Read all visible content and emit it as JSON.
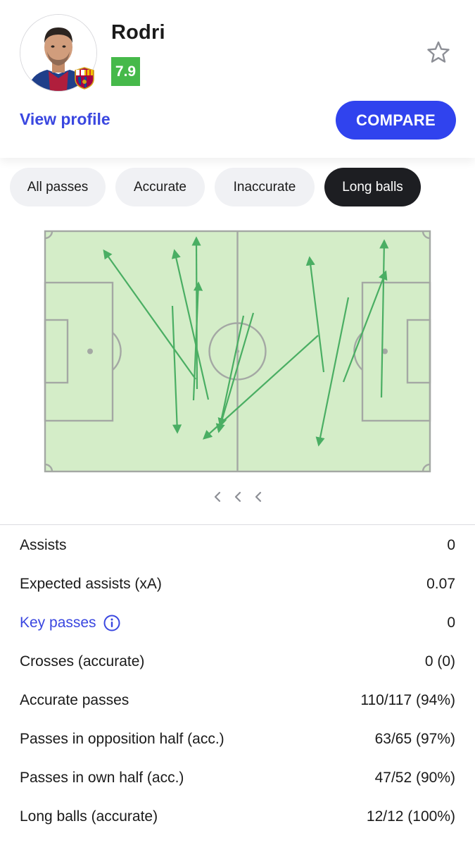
{
  "player": {
    "name": "Rodri",
    "rating": "7.9",
    "rating_color": "#46b94a",
    "club_badge": "fc-barcelona-crest",
    "view_profile_label": "View profile",
    "compare_label": "COMPARE"
  },
  "filters": [
    {
      "label": "All passes",
      "active": false
    },
    {
      "label": "Accurate",
      "active": false
    },
    {
      "label": "Inaccurate",
      "active": false
    },
    {
      "label": "Long balls",
      "active": true
    }
  ],
  "pitch": {
    "pass_color": "#4aae63",
    "passes_shown": 12
  },
  "stats": [
    {
      "label": "Assists",
      "value": "0",
      "link": false
    },
    {
      "label": "Expected assists (xA)",
      "value": "0.07",
      "link": false
    },
    {
      "label": "Key passes",
      "value": "0",
      "link": true,
      "icon": "info-icon"
    },
    {
      "label": "Crosses (accurate)",
      "value": "0 (0)",
      "link": false
    },
    {
      "label": "Accurate passes",
      "value": "110/117 (94%)",
      "link": false
    },
    {
      "label": "Passes in opposition half (acc.)",
      "value": "63/65 (97%)",
      "link": false
    },
    {
      "label": "Passes in own half (acc.)",
      "value": "47/52 (90%)",
      "link": false
    },
    {
      "label": "Long balls (accurate)",
      "value": "12/12 (100%)",
      "link": false
    }
  ],
  "colors": {
    "accent": "#3043ee",
    "link": "#3a47e0",
    "pitch_fill": "#d4edc8",
    "pitch_lines": "#a4a8a4",
    "active_chip": "#1d1e22"
  }
}
